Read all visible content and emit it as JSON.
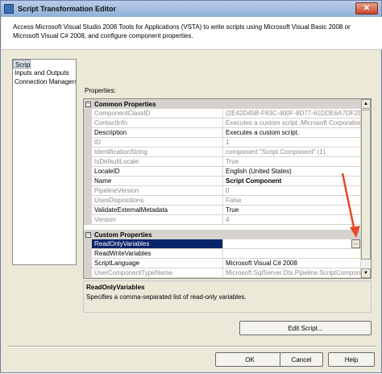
{
  "window": {
    "title": "Script Transformation Editor",
    "close_glyph": "✕"
  },
  "header": {
    "description": "Access Microsoft Visual Studio 2008 Tools for Applications (VSTA) to write scripts using Microsoft Visual Basic 2008 or Microsoft Visual C# 2008, and configure component properties."
  },
  "nav": {
    "items": [
      {
        "label": "Script",
        "selected": true
      },
      {
        "label": "Inputs and Outputs"
      },
      {
        "label": "Connection Managers"
      }
    ]
  },
  "properties": {
    "label": "Properties:",
    "categories": [
      {
        "name": "Common Properties",
        "toggle": "−",
        "rows": [
          {
            "name": "ComponentClassID",
            "value": "{2E42D45B-F83C-400F-8D77-61DDE6A7DF29}",
            "readonly": true
          },
          {
            "name": "ContactInfo",
            "value": "Executes a custom script.;Microsoft Corporation;",
            "readonly": true
          },
          {
            "name": "Description",
            "value": "Executes a custom script."
          },
          {
            "name": "ID",
            "value": "1",
            "readonly": true
          },
          {
            "name": "IdentificationString",
            "value": "component \"Script Component\" (1)",
            "readonly": true
          },
          {
            "name": "IsDefaultLocale",
            "value": "True",
            "readonly": true
          },
          {
            "name": "LocaleID",
            "value": "English (United States)"
          },
          {
            "name": "Name",
            "value": "Script Component",
            "bold": true
          },
          {
            "name": "PipelineVersion",
            "value": "0",
            "readonly": true
          },
          {
            "name": "UsesDispositions",
            "value": "False",
            "readonly": true
          },
          {
            "name": "ValidateExternalMetadata",
            "value": "True"
          },
          {
            "name": "Version",
            "value": "4",
            "readonly": true
          }
        ]
      },
      {
        "name": "Custom Properties",
        "toggle": "−",
        "rows": [
          {
            "name": "ReadOnlyVariables",
            "value": "",
            "selected": true,
            "ellipsis": "..."
          },
          {
            "name": "ReadWriteVariables",
            "value": ""
          },
          {
            "name": "ScriptLanguage",
            "value": "Microsoft Visual C# 2008"
          },
          {
            "name": "UserComponentTypeName",
            "value": "Microsoft.SqlServer.Dts.Pipeline.ScriptComponent",
            "readonly": true
          }
        ]
      }
    ],
    "scroll_up": "▲",
    "scroll_down": "▼"
  },
  "help": {
    "title": "ReadOnlyVariables",
    "text": "Specifies a comma-separated list of read-only variables."
  },
  "buttons": {
    "edit_script": "Edit Script...",
    "ok": "OK",
    "cancel": "Cancel",
    "help": "Help"
  },
  "colors": {
    "selection": "#0a246a",
    "arrow": "#e8492a",
    "title_gradient_top": "#b9cde8"
  }
}
